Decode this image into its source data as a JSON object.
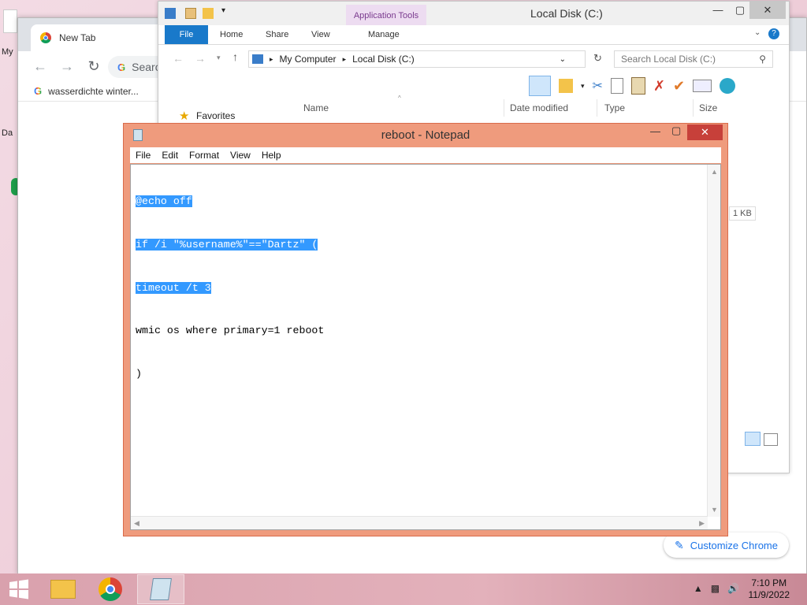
{
  "desktop": {
    "fragments": [
      "My",
      "Da"
    ]
  },
  "chrome": {
    "tab_title": "New Tab",
    "omnibox_placeholder": "Searc",
    "bookmark": "wasserdichte winter...",
    "customize_label": "Customize Chrome"
  },
  "explorer": {
    "title": "Local Disk (C:)",
    "app_tools": "Application Tools",
    "tabs": [
      "File",
      "Home",
      "Share",
      "View",
      "Manage"
    ],
    "breadcrumb": [
      "My Computer",
      "Local Disk (C:)"
    ],
    "search_placeholder": "Search Local Disk (C:)",
    "nav_favorites": "Favorites",
    "columns": [
      "Name",
      "Date modified",
      "Type",
      "Size"
    ],
    "file_size": "1 KB"
  },
  "notepad": {
    "title": "reboot - Notepad",
    "menu": [
      "File",
      "Edit",
      "Format",
      "View",
      "Help"
    ],
    "lines": [
      {
        "text": "@echo off",
        "selected": true
      },
      {
        "text": "if /i \"%username%\"==\"Dartz\" (",
        "selected": true
      },
      {
        "text": "timeout /t 3",
        "selected": true
      },
      {
        "text": "wmic os where primary=1 reboot",
        "selected": false
      },
      {
        "text": ")",
        "selected": false
      }
    ]
  },
  "taskbar": {
    "time": "7:10 PM",
    "date": "11/9/2022"
  },
  "colors": {
    "selection": "#3399ff",
    "notepad_frame": "#ef9b7d",
    "ribbon_file": "#1979ca",
    "chrome_link": "#1a73e8"
  }
}
